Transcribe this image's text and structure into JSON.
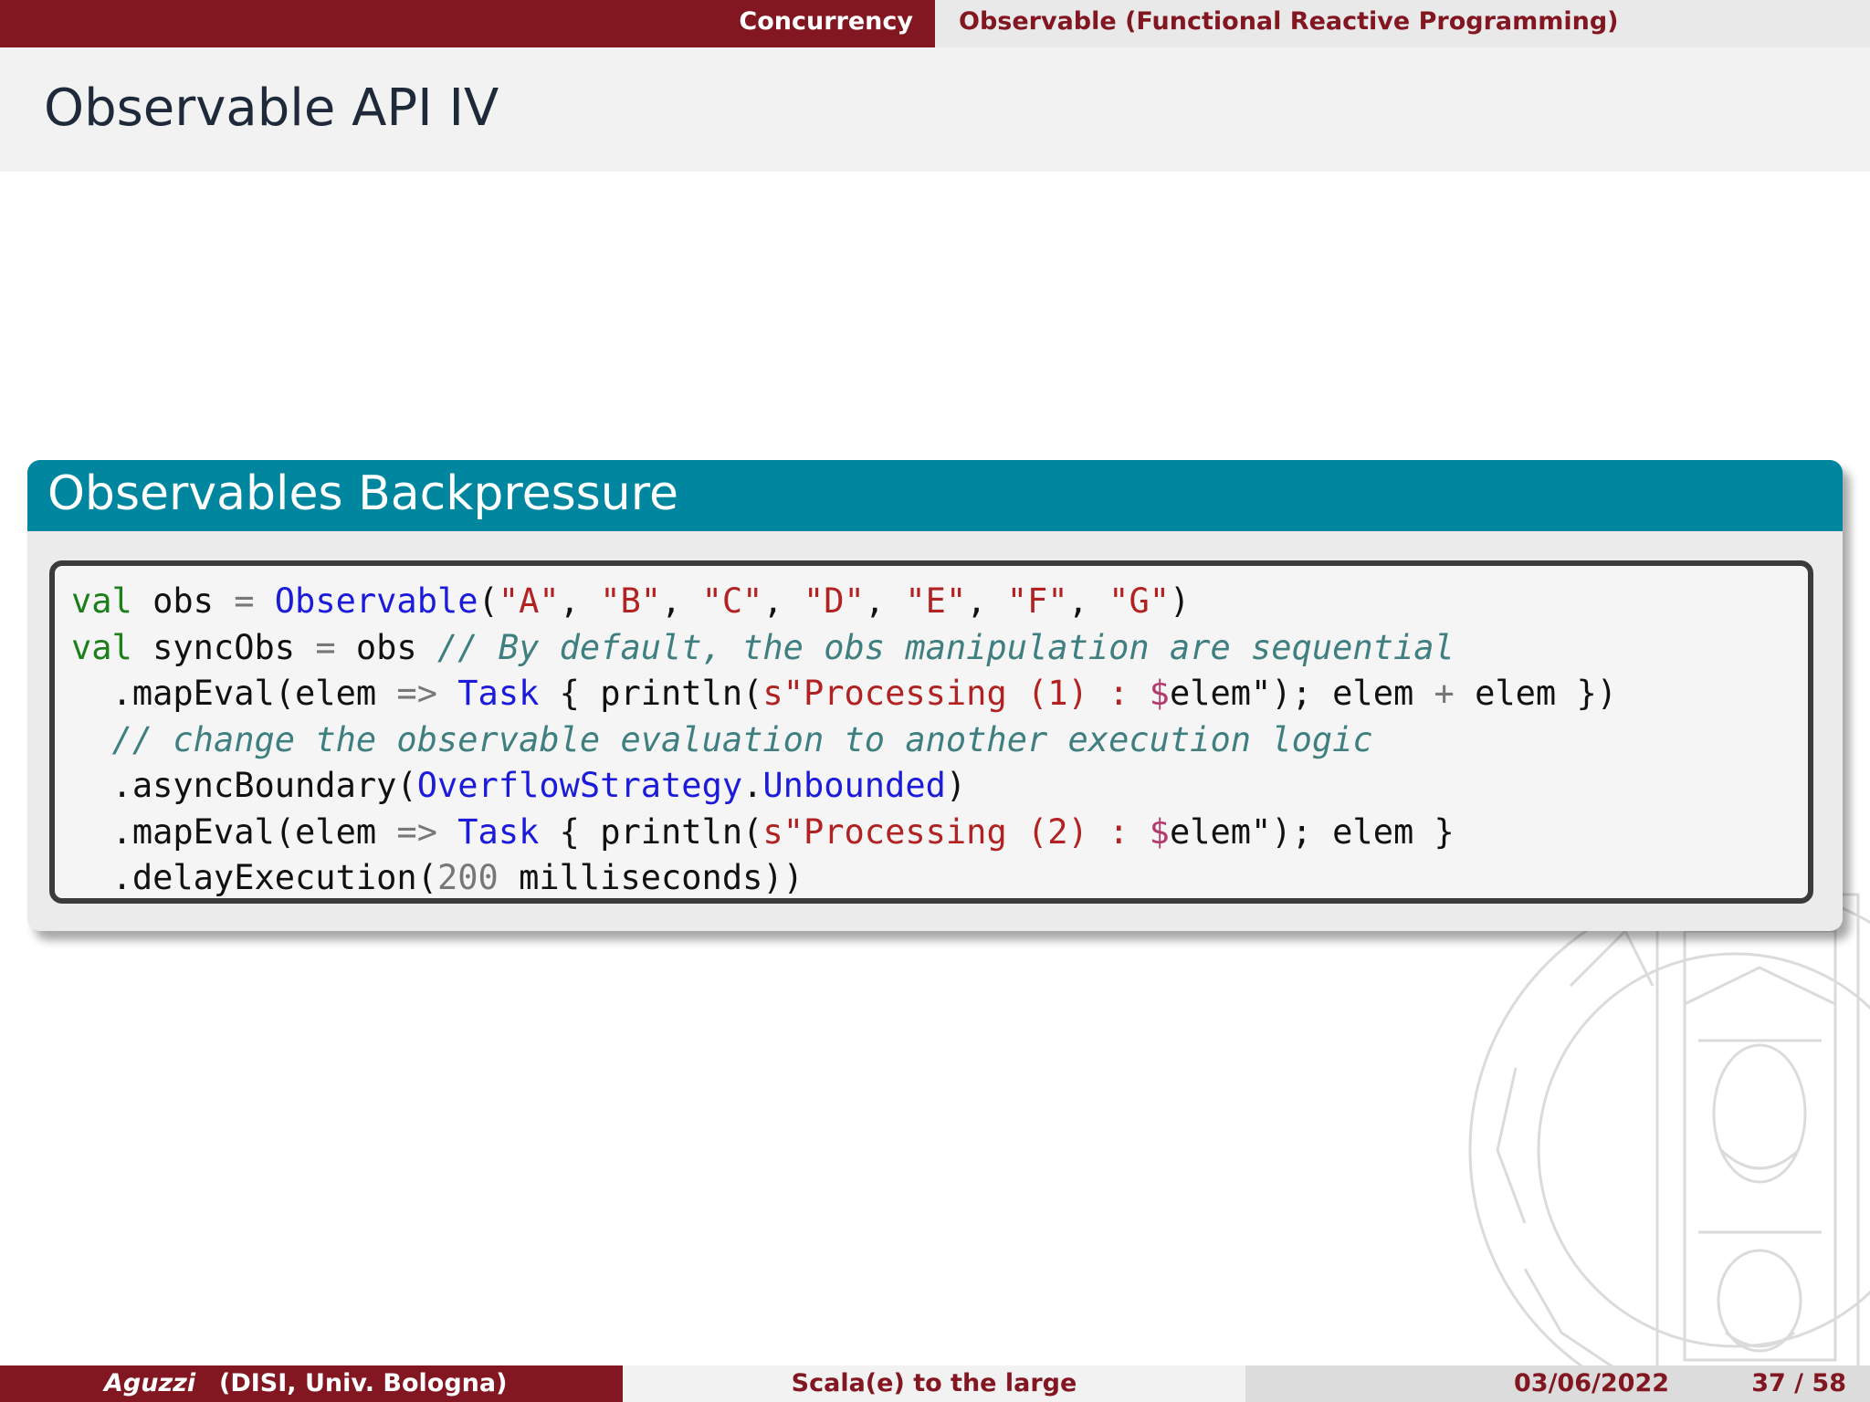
{
  "nav": {
    "section": "Concurrency",
    "subsection": "Observable (Functional Reactive Programming)"
  },
  "frame": {
    "title": "Observable API IV"
  },
  "block": {
    "title": "Observables Backpressure",
    "code": [
      [
        [
          "kw",
          "val"
        ],
        [
          "tx",
          " obs "
        ],
        [
          "op",
          "="
        ],
        [
          "tx",
          " "
        ],
        [
          "ty",
          "Observable"
        ],
        [
          "tx",
          "("
        ],
        [
          "st",
          "\"A\""
        ],
        [
          "tx",
          ", "
        ],
        [
          "st",
          "\"B\""
        ],
        [
          "tx",
          ", "
        ],
        [
          "st",
          "\"C\""
        ],
        [
          "tx",
          ", "
        ],
        [
          "st",
          "\"D\""
        ],
        [
          "tx",
          ", "
        ],
        [
          "st",
          "\"E\""
        ],
        [
          "tx",
          ", "
        ],
        [
          "st",
          "\"F\""
        ],
        [
          "tx",
          ", "
        ],
        [
          "st",
          "\"G\""
        ],
        [
          "tx",
          ")"
        ]
      ],
      [
        [
          "kw",
          "val"
        ],
        [
          "tx",
          " syncObs "
        ],
        [
          "op",
          "="
        ],
        [
          "tx",
          " obs "
        ],
        [
          "cm",
          "// By default, the obs manipulation are sequential"
        ]
      ],
      [
        [
          "tx",
          "  .mapEval(elem "
        ],
        [
          "op",
          "=>"
        ],
        [
          "tx",
          " "
        ],
        [
          "ty",
          "Task"
        ],
        [
          "tx",
          " { println("
        ],
        [
          "st",
          "s\"Processing (1) : "
        ],
        [
          "dl",
          "$"
        ],
        [
          "tx",
          "elem\"); elem "
        ],
        [
          "op",
          "+"
        ],
        [
          "tx",
          " elem })"
        ]
      ],
      [
        [
          "tx",
          "  "
        ],
        [
          "cm",
          "// change the observable evaluation to another execution logic"
        ]
      ],
      [
        [
          "tx",
          "  .asyncBoundary("
        ],
        [
          "ty",
          "OverflowStrategy"
        ],
        [
          "tx",
          "."
        ],
        [
          "ty",
          "Unbounded"
        ],
        [
          "tx",
          ")"
        ]
      ],
      [
        [
          "tx",
          "  .mapEval(elem "
        ],
        [
          "op",
          "=>"
        ],
        [
          "tx",
          " "
        ],
        [
          "ty",
          "Task"
        ],
        [
          "tx",
          " { println("
        ],
        [
          "st",
          "s\"Processing (2) : "
        ],
        [
          "dl",
          "$"
        ],
        [
          "tx",
          "elem\"); elem }"
        ]
      ],
      [
        [
          "tx",
          "  .delayExecution("
        ],
        [
          "nm",
          "200"
        ],
        [
          "tx",
          " milliseconds))"
        ]
      ]
    ]
  },
  "footer": {
    "author": "Aguzzi",
    "institute": "(DISI, Univ. Bologna)",
    "talk": "Scala(e) to the large",
    "date": "03/06/2022",
    "page": "37 / 58"
  },
  "colors": {
    "bordeaux": "#821621",
    "block_teal": "#00879f",
    "keyword": "#1c7f1c",
    "type": "#1b1bd9",
    "string": "#b22222",
    "comment": "#3f7f7f"
  },
  "icons": {
    "watermark": "university-seal-icon"
  }
}
